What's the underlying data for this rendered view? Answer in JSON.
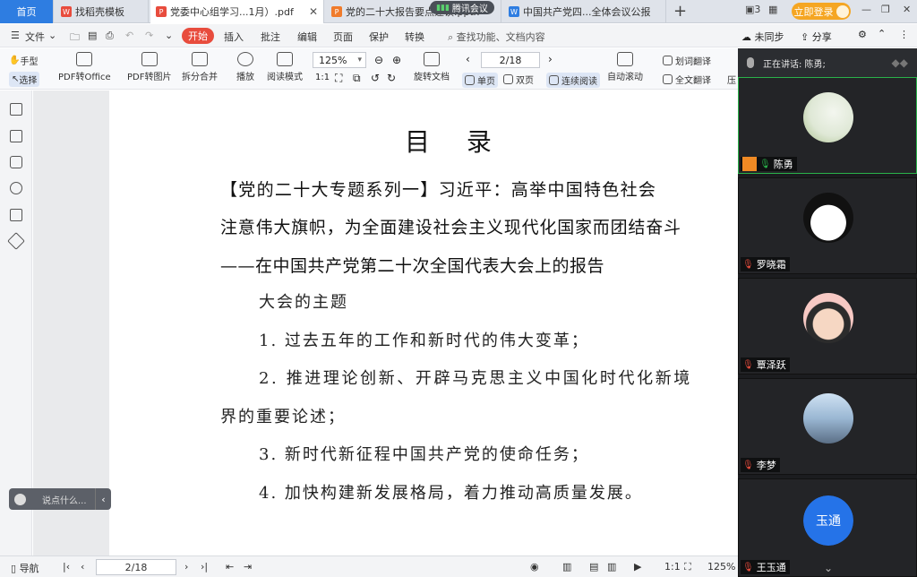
{
  "tabs": [
    {
      "label": "首页",
      "kind": "home"
    },
    {
      "label": "找稻壳模板",
      "kind": "template",
      "color": "#e84c3d"
    },
    {
      "label": "党委中心组学习...1月）.pdf",
      "kind": "pdf",
      "color": "#e84c3d",
      "active": true
    },
    {
      "label": "党的二十大报告要点速读.pptx",
      "kind": "ppt",
      "color": "#f07b2b"
    },
    {
      "label": "中国共产党四...全体会议公报",
      "kind": "word",
      "color": "#2e7de1"
    }
  ],
  "tencent_meeting_label": "腾讯会议",
  "login_label": "立即登录",
  "menu": {
    "file": "文件",
    "start": "开始",
    "items": [
      "插入",
      "批注",
      "编辑",
      "页面",
      "保护",
      "转换"
    ],
    "search_placeholder": "查找功能、文档内容",
    "sync": "未同步",
    "share": "分享"
  },
  "toolbar": {
    "hand": "手型",
    "select": "选择",
    "pdf_to_office": "PDF转Office",
    "pdf_to_image": "PDF转图片",
    "split_merge": "拆分合并",
    "play": "播放",
    "read_mode": "阅读模式",
    "zoom": "125%",
    "page": "2/18",
    "rotate": "旋转文档",
    "single": "单页",
    "double": "双页",
    "continuous": "连续阅读",
    "auto_scroll": "自动滚动",
    "word_translate": "划词翻译",
    "full_translate": "全文翻译",
    "compress": "压"
  },
  "document": {
    "title": "目 录",
    "heading_lines": [
      "【党的二十大专题系列一】习近平：高举中国特色社会",
      "注意伟大旗帜，为全面建设社会主义现代化国家而团结奋斗",
      "——在中国共产党第二十次全国代表大会上的报告"
    ],
    "subtitle": "大会的主题",
    "items": [
      "1.   过去五年的工作和新时代的伟大变革；",
      "2.   推进理论创新、开辟马克思主义中国化时代化新境",
      "界的重要论述；",
      "3.   新时代新征程中国共产党的使命任务；",
      "4.   加快构建新发展格局，着力推动高质量发展。"
    ]
  },
  "chat_placeholder": "说点什么...",
  "statusbar": {
    "nav": "导航",
    "page": "2/18",
    "zoom": "125%"
  },
  "meeting": {
    "speaking_label": "正在讲话: 陈勇;",
    "participants": [
      {
        "name": "陈勇",
        "mic": "on",
        "host": true,
        "avatar": "photo-landscape"
      },
      {
        "name": "罗晓霜",
        "mic": "muted",
        "avatar": "cartoon-girl"
      },
      {
        "name": "覃泽跃",
        "mic": "muted",
        "avatar": "cartoon-boy"
      },
      {
        "name": "李梦",
        "mic": "muted",
        "avatar": "photo-person"
      },
      {
        "name": "王玉通",
        "mic": "muted",
        "avatar": "text",
        "avatar_text": "玉通"
      }
    ]
  }
}
